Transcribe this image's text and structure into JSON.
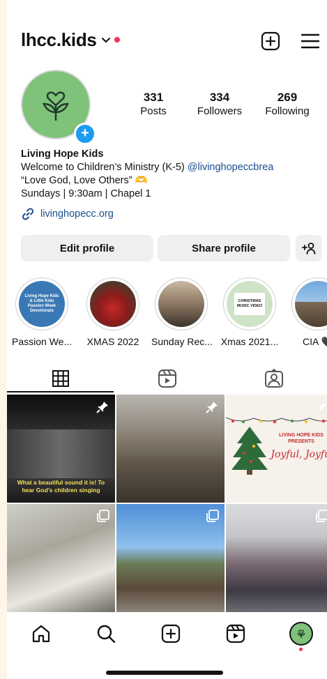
{
  "header": {
    "username": "lhcc.kids"
  },
  "profile": {
    "stats": [
      {
        "value": "331",
        "label": "Posts"
      },
      {
        "value": "334",
        "label": "Followers"
      },
      {
        "value": "269",
        "label": "Following"
      }
    ],
    "name": "Living Hope Kids",
    "bio_line1_text": "Welcome to Children’s Ministry (K-5) ",
    "bio_line1_mention": "@livinghopeccbrea",
    "bio_line2": "“Love God, Love Others” 🫶",
    "bio_line3": "Sundays | 9:30am | Chapel 1",
    "link": "livinghopecc.org"
  },
  "buttons": {
    "edit": "Edit profile",
    "share": "Share profile"
  },
  "highlights": [
    {
      "label": "Passion We..."
    },
    {
      "label": "XMAS 2022"
    },
    {
      "label": "Sunday Rec..."
    },
    {
      "label": "Xmas 2021..."
    },
    {
      "label": "CIA 🖤"
    }
  ],
  "posts": {
    "post1_caption": "What a beautiful sound it is! To hear God’s children singing",
    "post3_title": "LIVING HOPE KIDS PRESENTS",
    "post3_script": "Joyful, Joyful"
  },
  "highlight_thumbs": {
    "hl1_text": "Living Hope Kids & Little Kids Passion Week Devotionals",
    "hl4_text": "CHRISTMAS MUSIC VIDEO"
  },
  "colors": {
    "accent_blue": "#1d9bf0",
    "link_blue": "#1a4d8f",
    "notification_red": "#ff2d55",
    "avatar_green": "#7fc27a"
  }
}
